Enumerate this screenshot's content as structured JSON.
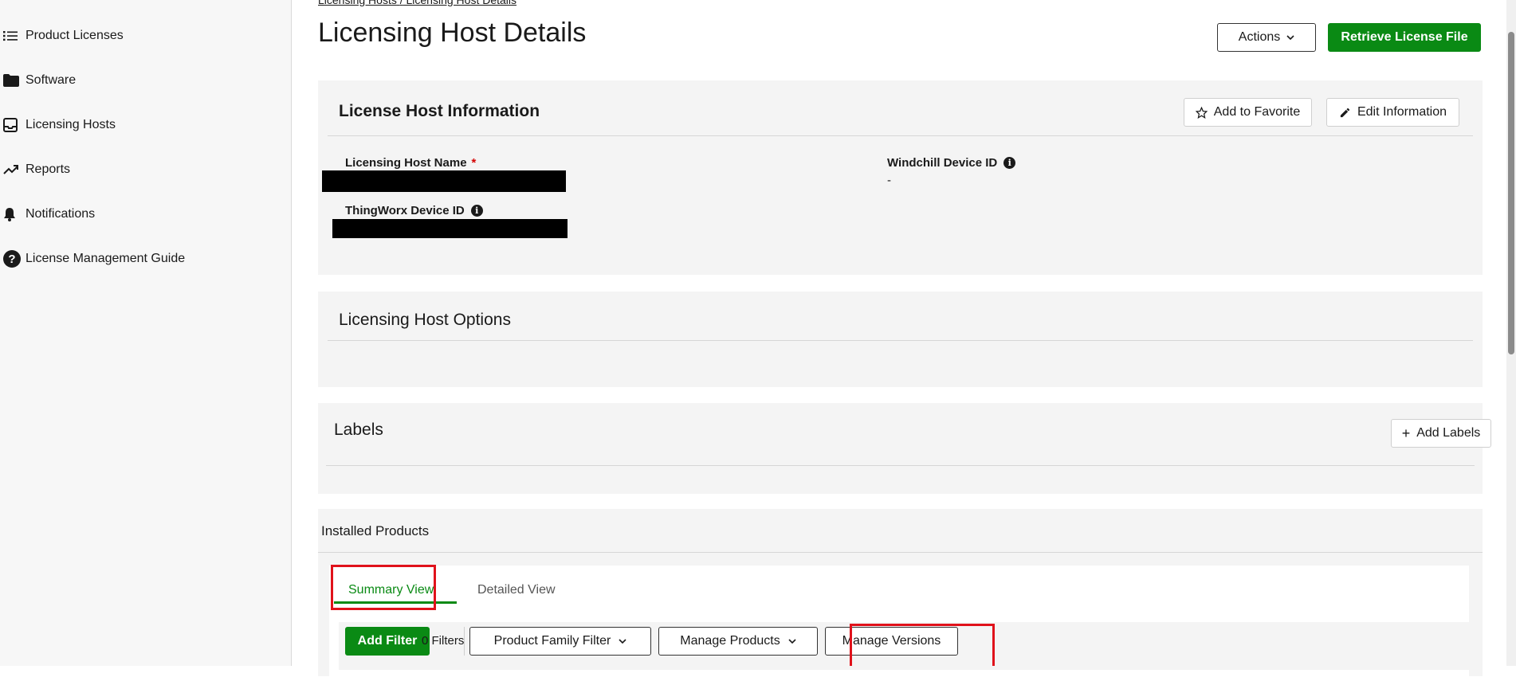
{
  "sidebar": {
    "items": [
      {
        "label": "Product Licenses",
        "icon": "list-icon"
      },
      {
        "label": "Software",
        "icon": "folder-icon"
      },
      {
        "label": "Licensing Hosts",
        "icon": "inbox-icon"
      },
      {
        "label": "Reports",
        "icon": "trend-up-icon"
      },
      {
        "label": "Notifications",
        "icon": "bell-icon"
      },
      {
        "label": "License Management Guide",
        "icon": "help-circle-icon"
      }
    ]
  },
  "breadcrumb": {
    "parent": "Licensing Hosts",
    "separator": "/",
    "current": "Licensing Host Details"
  },
  "header": {
    "title": "Licensing Host Details",
    "actions_label": "Actions",
    "retrieve_label": "Retrieve License File"
  },
  "host_info": {
    "title": "License Host Information",
    "favorite_label": "Add to Favorite",
    "edit_label": "Edit Information",
    "host_name_label": "Licensing Host Name",
    "required_mark": "*",
    "thingworx_label": "ThingWorx Device ID",
    "windchill_label": "Windchill Device ID",
    "windchill_value": "-",
    "info_glyph": "i"
  },
  "options": {
    "title": "Licensing Host Options"
  },
  "labels": {
    "title": "Labels",
    "add_label": "Add Labels"
  },
  "installed": {
    "title": "Installed Products",
    "tabs": [
      {
        "label": "Summary View",
        "active": true
      },
      {
        "label": "Detailed View",
        "active": false
      }
    ],
    "toolbar": {
      "add_filter": "Add Filter",
      "filters_count": "0 Filters",
      "product_family": "Product Family Filter",
      "manage_products": "Manage Products",
      "manage_versions": "Manage Versions"
    }
  },
  "colors": {
    "accent_green": "#0a8a14",
    "highlight_red": "#e0121b",
    "panel_bg": "#f4f4f4"
  }
}
